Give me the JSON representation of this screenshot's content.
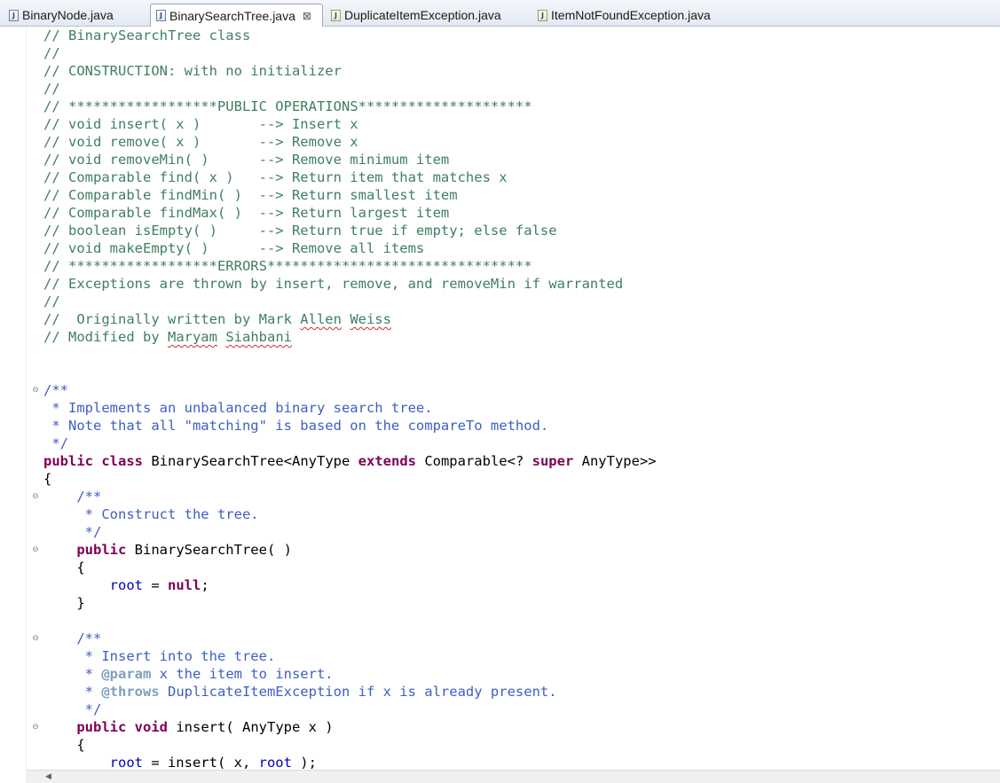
{
  "tabs": [
    {
      "label": "BinaryNode.java",
      "icon": "java-file-icon",
      "active": false
    },
    {
      "label": "BinarySearchTree.java",
      "icon": "java-file-icon",
      "active": true,
      "close": "⊠"
    },
    {
      "label": "DuplicateItemException.java",
      "icon": "java-file-warning-icon",
      "active": false
    },
    {
      "label": "ItemNotFoundException.java",
      "icon": "java-file-warning-icon",
      "active": false
    }
  ],
  "fold_marker": "⊖",
  "scroll_left": "◀",
  "lines": [
    [
      {
        "t": "// BinarySearchTree class",
        "c": "c"
      }
    ],
    [
      {
        "t": "//",
        "c": "c"
      }
    ],
    [
      {
        "t": "// CONSTRUCTION: with no initializer",
        "c": "c"
      }
    ],
    [
      {
        "t": "//",
        "c": "c"
      }
    ],
    [
      {
        "t": "// ******************PUBLIC OPERATIONS*********************",
        "c": "c"
      }
    ],
    [
      {
        "t": "// void insert( x )       --> Insert x",
        "c": "c"
      }
    ],
    [
      {
        "t": "// void remove( x )       --> Remove x",
        "c": "c"
      }
    ],
    [
      {
        "t": "// void removeMin( )      --> Remove minimum item",
        "c": "c"
      }
    ],
    [
      {
        "t": "// Comparable find( x )   --> Return item that matches x",
        "c": "c"
      }
    ],
    [
      {
        "t": "// Comparable findMin( )  --> Return smallest item",
        "c": "c"
      }
    ],
    [
      {
        "t": "// Comparable findMax( )  --> Return largest item",
        "c": "c"
      }
    ],
    [
      {
        "t": "// boolean isEmpty( )     --> Return true if empty; else false",
        "c": "c"
      }
    ],
    [
      {
        "t": "// void makeEmpty( )      --> Remove all items",
        "c": "c"
      }
    ],
    [
      {
        "t": "// ******************ERRORS********************************",
        "c": "c"
      }
    ],
    [
      {
        "t": "// Exceptions are thrown by insert, remove, and removeMin if warranted",
        "c": "c"
      }
    ],
    [
      {
        "t": "//",
        "c": "c"
      }
    ],
    [
      {
        "t": "//  Originally written by Mark ",
        "c": "c"
      },
      {
        "t": "Allen",
        "c": "c sq"
      },
      {
        "t": " ",
        "c": "c"
      },
      {
        "t": "Weiss",
        "c": "c sq"
      }
    ],
    [
      {
        "t": "// Modified by ",
        "c": "c"
      },
      {
        "t": "Maryam",
        "c": "c sq"
      },
      {
        "t": " ",
        "c": "c"
      },
      {
        "t": "Siahbani",
        "c": "c sq"
      }
    ],
    [],
    [],
    [
      {
        "t": "/**",
        "c": "jd"
      }
    ],
    [
      {
        "t": " * Implements an unbalanced binary search tree.",
        "c": "jd"
      }
    ],
    [
      {
        "t": " * Note that all \"matching\" is based on the compareTo method.",
        "c": "jd"
      }
    ],
    [
      {
        "t": " */",
        "c": "jd"
      }
    ],
    [
      {
        "t": "public",
        "c": "kw"
      },
      {
        "t": " ",
        "c": "pl"
      },
      {
        "t": "class",
        "c": "kw"
      },
      {
        "t": " BinarySearchTree<AnyType ",
        "c": "pl"
      },
      {
        "t": "extends",
        "c": "kw"
      },
      {
        "t": " Comparable<? ",
        "c": "pl"
      },
      {
        "t": "super",
        "c": "kw"
      },
      {
        "t": " AnyType>>",
        "c": "pl"
      }
    ],
    [
      {
        "t": "{",
        "c": "pl"
      }
    ],
    [
      {
        "t": "    /**",
        "c": "jd"
      }
    ],
    [
      {
        "t": "     * Construct the tree.",
        "c": "jd"
      }
    ],
    [
      {
        "t": "     */",
        "c": "jd"
      }
    ],
    [
      {
        "t": "    ",
        "c": "pl"
      },
      {
        "t": "public",
        "c": "kw"
      },
      {
        "t": " BinarySearchTree( )",
        "c": "pl"
      }
    ],
    [
      {
        "t": "    {",
        "c": "pl"
      }
    ],
    [
      {
        "t": "        ",
        "c": "pl"
      },
      {
        "t": "root",
        "c": "fld"
      },
      {
        "t": " = ",
        "c": "pl"
      },
      {
        "t": "null",
        "c": "kw"
      },
      {
        "t": ";",
        "c": "pl"
      }
    ],
    [
      {
        "t": "    }",
        "c": "pl"
      }
    ],
    [],
    [
      {
        "t": "    /**",
        "c": "jd"
      }
    ],
    [
      {
        "t": "     * Insert into the tree.",
        "c": "jd"
      }
    ],
    [
      {
        "t": "     * ",
        "c": "jd"
      },
      {
        "t": "@param",
        "c": "tag"
      },
      {
        "t": " x the item to insert.",
        "c": "jd"
      }
    ],
    [
      {
        "t": "     * ",
        "c": "jd"
      },
      {
        "t": "@throws",
        "c": "tag"
      },
      {
        "t": " DuplicateItemException if x is already present.",
        "c": "jd"
      }
    ],
    [
      {
        "t": "     */",
        "c": "jd"
      }
    ],
    [
      {
        "t": "    ",
        "c": "pl"
      },
      {
        "t": "public",
        "c": "kw"
      },
      {
        "t": " ",
        "c": "pl"
      },
      {
        "t": "void",
        "c": "kw"
      },
      {
        "t": " insert( AnyType x )",
        "c": "pl"
      }
    ],
    [
      {
        "t": "    {",
        "c": "pl"
      }
    ],
    [
      {
        "t": "        ",
        "c": "pl"
      },
      {
        "t": "root",
        "c": "fld"
      },
      {
        "t": " = insert( x, ",
        "c": "pl"
      },
      {
        "t": "root",
        "c": "fld"
      },
      {
        "t": " );",
        "c": "pl"
      }
    ]
  ]
}
